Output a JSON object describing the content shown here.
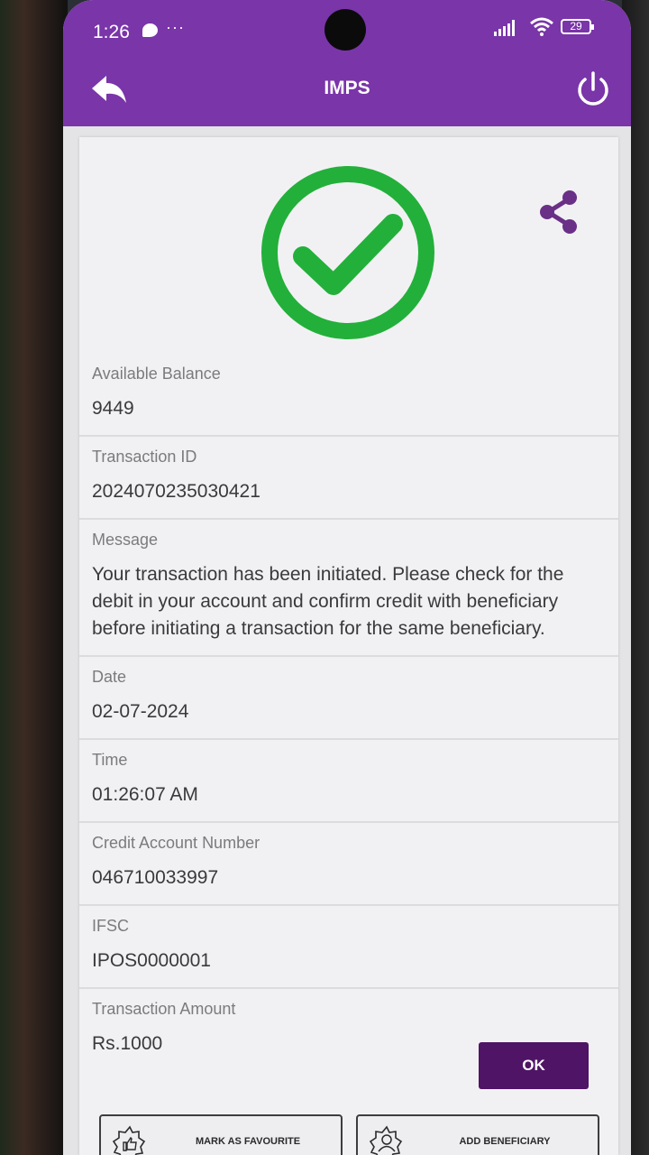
{
  "status_bar": {
    "time": "1:26",
    "dots": "···",
    "battery": "29"
  },
  "app_bar": {
    "title": "IMPS"
  },
  "details": [
    {
      "label": "Available Balance",
      "value": "9449"
    },
    {
      "label": "Transaction ID",
      "value": "2024070235030421"
    },
    {
      "label": "Message",
      "value": "Your transaction has been initiated. Please check for the debit in your account and confirm credit with beneficiary before initiating a transaction for the same beneficiary."
    },
    {
      "label": "Date",
      "value": "02-07-2024"
    },
    {
      "label": "Time",
      "value": "01:26:07 AM"
    },
    {
      "label": "Credit Account Number",
      "value": "046710033997"
    },
    {
      "label": "IFSC",
      "value": "IPOS0000001"
    },
    {
      "label": "Transaction Amount",
      "value": "Rs.1000"
    }
  ],
  "buttons": {
    "ok": "OK",
    "mark_favourite": "MARK AS FAVOURITE",
    "add_beneficiary": "ADD BENEFICIARY"
  },
  "colors": {
    "brand": "#7a35a9",
    "button_dark": "#4f1465",
    "success": "#22b03a"
  },
  "icons": {
    "back": "back-arrow-icon",
    "power": "power-icon",
    "success": "success-check-icon",
    "share": "share-icon",
    "favourite": "thumbs-up-icon",
    "beneficiary": "user-icon"
  }
}
